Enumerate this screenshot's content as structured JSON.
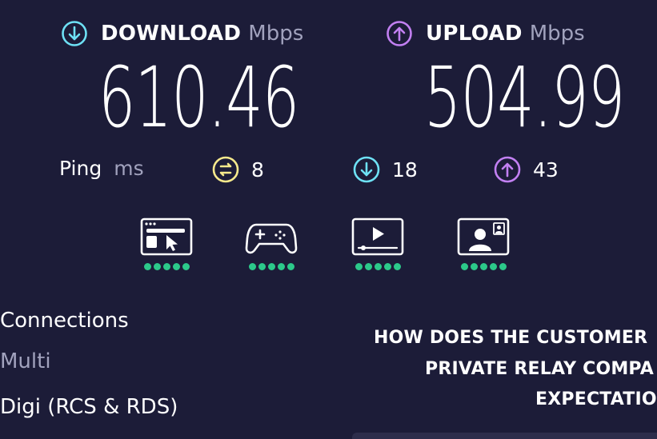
{
  "download": {
    "label": "DOWNLOAD",
    "unit": "Mbps",
    "value": "610.46",
    "icon": "download-arrow-icon",
    "color": "#6ee1f5"
  },
  "upload": {
    "label": "UPLOAD",
    "unit": "Mbps",
    "value": "504.99",
    "icon": "upload-arrow-icon",
    "color": "#c280f2"
  },
  "ping": {
    "label": "Ping",
    "unit": "ms",
    "unloaded": {
      "value": "8",
      "icon": "idle-latency-icon",
      "color": "#f6e98c"
    },
    "download": {
      "value": "18",
      "icon": "download-latency-icon",
      "color": "#6ee1f5"
    },
    "upload": {
      "value": "43",
      "icon": "upload-latency-icon",
      "color": "#c280f2"
    }
  },
  "quality": [
    {
      "icon": "web-browsing-icon",
      "rating": 5
    },
    {
      "icon": "gaming-controller-icon",
      "rating": 5
    },
    {
      "icon": "video-streaming-icon",
      "rating": 5
    },
    {
      "icon": "video-call-icon",
      "rating": 5
    }
  ],
  "rating_color": "#2cc98a",
  "connections": {
    "heading": "Connections",
    "mode": "Multi",
    "isp": "Digi (RCS & RDS)"
  },
  "survey": {
    "line1": "HOW DOES THE CUSTOMER",
    "line2": "PRIVATE RELAY COMPA",
    "line3": "EXPECTATIO"
  }
}
